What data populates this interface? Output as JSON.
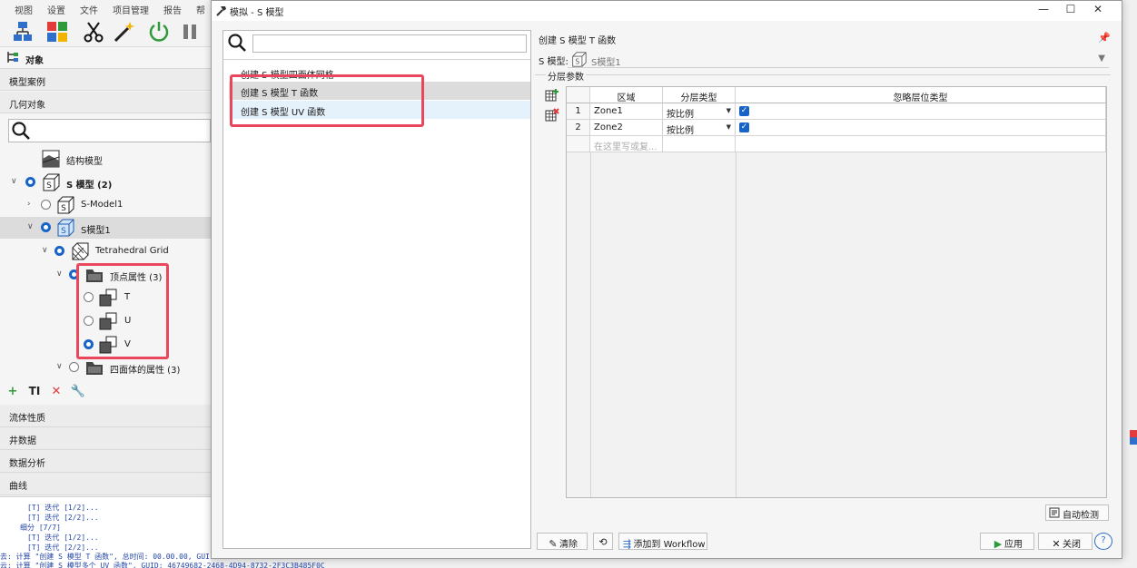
{
  "app": {
    "menu": [
      "视图",
      "设置",
      "文件",
      "项目管理",
      "报告",
      "帮"
    ],
    "left_panel": {
      "header": "对象",
      "sections": [
        "模型案例",
        "几何对象"
      ],
      "tree": [
        {
          "label": "结构模型"
        },
        {
          "label": "S 模型 (2)"
        },
        {
          "label": "S-Model1"
        },
        {
          "label": "S模型1"
        },
        {
          "label": "Tetrahedral Grid"
        },
        {
          "label": "顶点属性 (3)"
        },
        {
          "label": "T"
        },
        {
          "label": "U"
        },
        {
          "label": "V"
        },
        {
          "label": "四面体的属性 (3)"
        }
      ],
      "bottom_sections": [
        "流体性质",
        "井数据",
        "数据分析",
        "曲线"
      ]
    },
    "log": [
      "[T] 迭代 [1/2]...",
      "[T] 迭代 [2/2]...",
      "细分 [7/7]",
      "[T] 迭代 [1/2]...",
      "[T] 迭代 [2/2]...",
      "去: 计算 \"创建 S 模型 T 函数\", 总时间: 00.00.00, GUI",
      "云: 计算 \"创建 S 模型多个 UV 函数\", GUID: 46749682-2468-4D94-8732-2F3C3B485F0C"
    ]
  },
  "dialog": {
    "title": "模拟 - S 模型",
    "list_items": [
      "创建 S 模型四面体网格",
      "创建 S 模型 T 函数",
      "创建 S 模型 UV 函数"
    ],
    "panel_title": "创建 S 模型 T 函数",
    "model_label": "S 模型:",
    "model_value": "S模型1",
    "group_label": "分层参数",
    "table": {
      "headers": [
        "区域",
        "分层类型",
        "忽略层位类型"
      ],
      "rows": [
        {
          "num": "1",
          "zone": "Zone1",
          "type": "按比例",
          "checked": true
        },
        {
          "num": "2",
          "zone": "Zone2",
          "type": "按比例",
          "checked": true
        }
      ],
      "placeholder": "在这里写或复..."
    },
    "auto_detect_label": "自动检测",
    "buttons": {
      "clear": "清除",
      "add_workflow": "添加到 Workflow",
      "apply": "应用",
      "close": "关闭"
    }
  },
  "colors": {
    "accent": "#1763c7",
    "highlight": "#e8475c"
  }
}
